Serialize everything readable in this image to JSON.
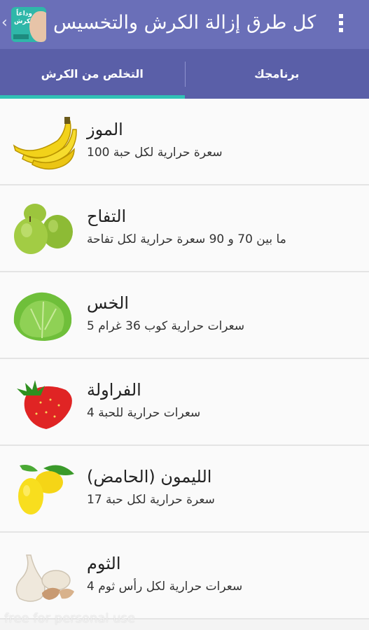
{
  "app": {
    "title": "كل طرق إزالة الكرش والتخسيس",
    "icon_text": "وداعاً للكرش"
  },
  "tabs": [
    {
      "label": "التخلص من الكرش",
      "active": true
    },
    {
      "label": "برنامجك",
      "active": false
    }
  ],
  "items": [
    {
      "name": "الموز",
      "calories": "100 سعرة حرارية لكل حبة",
      "icon": "banana-icon"
    },
    {
      "name": "التفاح",
      "calories": "ما بين 70 و 90 سعرة حرارية لكل تفاحة",
      "icon": "apple-icon"
    },
    {
      "name": "الخس",
      "calories": "5 سعرات حرارية كوب 36  غرام",
      "icon": "lettuce-icon"
    },
    {
      "name": "الفراولة",
      "calories": "4 سعرات حرارية للحبة",
      "icon": "strawberry-icon"
    },
    {
      "name": "الليمون (الحامض)",
      "calories": "17 سعرة حرارية لكل حبة",
      "icon": "lemon-icon"
    },
    {
      "name": "الثوم",
      "calories": "4 سعرات حرارية لكل رأس ثوم",
      "icon": "garlic-icon"
    }
  ],
  "watermark": "free for personal use",
  "colors": {
    "appbar": "#6a6fb8",
    "tabs": "#5a5fa8",
    "tab_indicator": "#31c1b6"
  }
}
